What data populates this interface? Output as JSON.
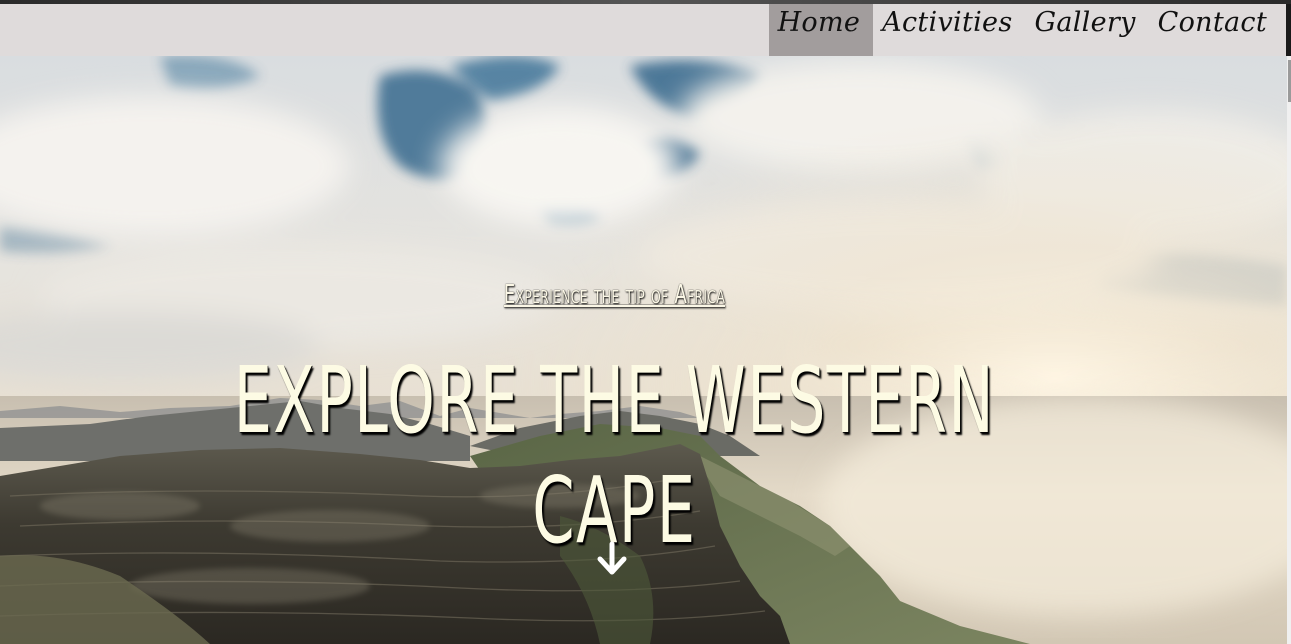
{
  "nav": {
    "items": [
      {
        "label": "Home",
        "active": true
      },
      {
        "label": "Activities",
        "active": false
      },
      {
        "label": "Gallery",
        "active": false
      },
      {
        "label": "Contact",
        "active": false
      }
    ]
  },
  "hero": {
    "tagline": "Experience the tip of Africa",
    "headline": "EXPLORE THE WESTERN CAPE",
    "scroll_icon": "arrow-down-icon"
  },
  "colors": {
    "nav_background": "#dfdbdb",
    "nav_active": "#a29d9d",
    "hero_text": "#fdfbe4"
  }
}
